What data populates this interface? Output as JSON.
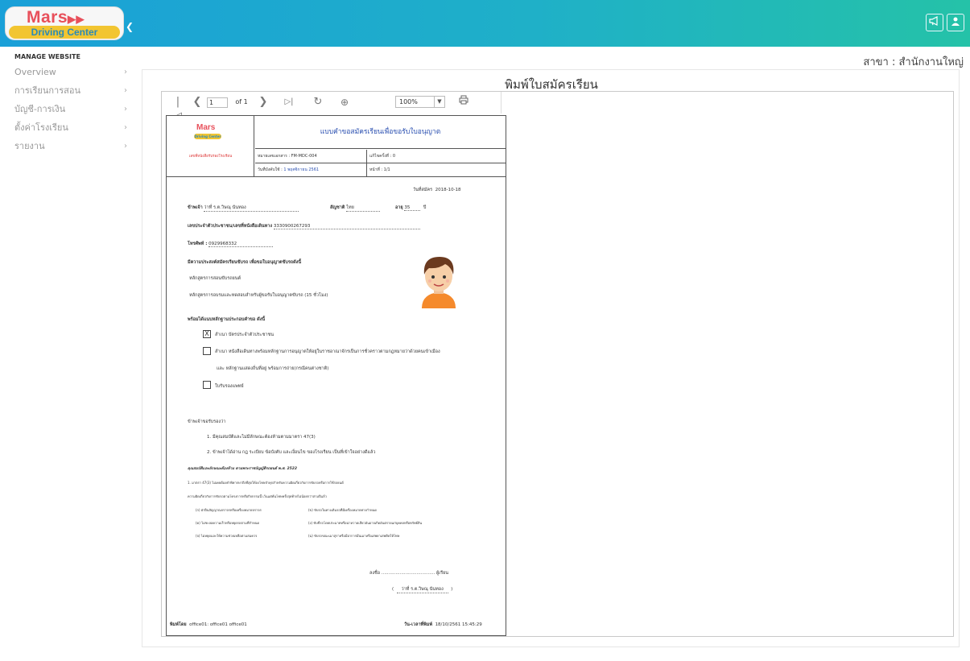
{
  "header": {
    "logo_top": "Mars",
    "logo_bottom": "Driving Center",
    "notify_icon": "megaphone-icon",
    "user_icon": "user-icon"
  },
  "sidebar": {
    "title": "MANAGE WEBSITE",
    "items": [
      {
        "label": "Overview"
      },
      {
        "label": "การเรียนการสอน"
      },
      {
        "label": "บัญชี-การเงิน"
      },
      {
        "label": "ตั้งค่าโรงเรียน"
      },
      {
        "label": "รายงาน"
      }
    ]
  },
  "main": {
    "branch": "สาขา : สำนักงานใหญ่",
    "title": "พิมพ์ใบสมัครเรียน"
  },
  "viewer": {
    "page_value": "1",
    "page_of": "of 1",
    "zoom": "100%"
  },
  "form": {
    "logo_top": "Mars",
    "logo_bottom": "Driving Center",
    "left_caption": "เลขที่หนังสือรับรองโรงเรียน",
    "title": "แบบคำขอสมัครเรียนเพื่อขอรับใบอนุญาต",
    "doc_no": "หมายเลขเอกสาร : FM-MDC-004",
    "revision": "แก้ไขครั้งที่ : 0",
    "effective_label": "วันที่บังคับใช้ :",
    "effective_date": "1 พฤศจิกายน 2561",
    "page_label": "หน้าที่ : 1/1",
    "apply_date_label": "วันที่สมัคร",
    "apply_date": "2018-10-18",
    "name_label": "ข้าพเจ้า",
    "name": "ว่าที่ ร.ต.วิษณุ นันทอง",
    "nationality_label": "สัญชาติ",
    "nationality": "ไทย",
    "age_label": "อายุ",
    "age": "35",
    "age_unit": "ปี",
    "id_label": "เลขประจำตัวประชาชน/เลขที่หนังสือเดินทาง",
    "id_number": "3330900267293",
    "phone_label": "โทรศัพท์ :",
    "phone": "0929968332",
    "purpose_heading": "มีความประสงค์สมัครเรียนขับรถ เพื่อขอใบอนุญาตขับรถดังนี้",
    "course1": "หลักสูตรการสอนขับรถยนต์",
    "course2": "หลักสูตรการอบรมและทดสอบสำหรับผู้ขอรับใบอนุญาตขับรถ (15 ชั่วโมง)",
    "docs_heading": "พร้อมได้แนบหลักฐานประกอบคำขอ ดังนี้",
    "doc1_check": "X",
    "doc1": "สำเนา บัตรประจำตัวประชาชน",
    "doc2": "สำเนา หนังสือเดินทางพร้อมหลักฐานการอนุญาตให้อยู่ในราชอาณาจักรเป็นการชั่วคราวตามกฎหมายว่าด้วยคนเข้าเมือง",
    "doc2b": "และ หลักฐานแสดงถิ่นที่อยู่ พร้อมการถ่าย(กรณีคนต่างชาติ)",
    "doc3": "ใบรับรองแพทย์",
    "declare": "ข้าพเจ้าขอรับรองว่า",
    "declare1": "1. มีคุณสมบัติและไม่มีลักษณะต้องห้ามตามมาตรา 47(3)",
    "declare2": "2. ข้าพเจ้าได้อ่าน กฎ ระเบียบ ข้อบังคับ และเงื่อนไข ของโรงเรียน เป็นที่เข้าใจอย่างดีแล้ว",
    "law_heading": "คุณสมบัติและลักษณะต้องห้าม ตามพระราชบัญญัติรถยนต์ พ.ศ. 2522",
    "law1": "1. มาตรา 47(3) ไม่เคยต้องคำพิพากษาถึงที่สุดให้ลงโทษจำคุกสำหรับความผิดเกี่ยวกับการขับรถหรือการใช้รถยนต์",
    "law2": "ความผิดเกี่ยวกับการขับรถตามโครงการหรือกิจกรรมนี้ เว้นแต่พ้นโทษครั้งสุดท้ายไม่น้อยกว่าสามปีแล้ว",
    "law_a": "(ก) ฝ่าฝืนสัญญาณจราจรหรือเครื่องหมายจราจร",
    "law_b": "(ข) ขับรถในทางเดินรถที่มีเครื่องหมายทางกำหนด",
    "law_c": "(ค) ไม่ชะลอความเร็วหรือหยุดรถตามที่กำหนด",
    "law_d": "(ง) ขับขี่รถโดยประมาทหรือน่าหวาดเสียวอันอาจเกิดอันตรายแก่บุคคลหรือทรัพย์สิน",
    "law_e": "(จ) ไม่หยุดและให้ความช่วยเหลือตามสมควร",
    "law_f": "(ฉ) ขับรถขณะเมาสุราหรือมีอาการมึนเมาหรือเสพยาเสพติดให้โทษ",
    "sign_label": "ลงชื่อ",
    "sign_line": "......................................",
    "sign_role": "ผู้เรียน",
    "sign_name": "ว่าที่ ร.ต.วิษณุ นันทอง",
    "printed_by_label": "พิมพ์โดย",
    "printed_by": "office01: office01 office01",
    "printed_at_label": "วัน-เวลาที่พิมพ์",
    "printed_at": "18/10/2561 15:45:29"
  }
}
